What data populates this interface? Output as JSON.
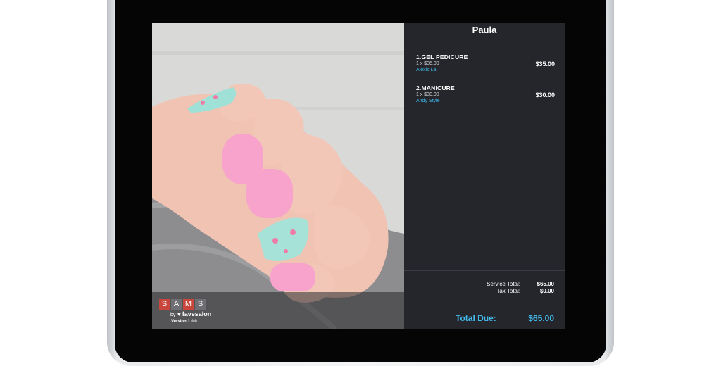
{
  "brand": {
    "logo_letters": [
      "S",
      "A",
      "M",
      "S"
    ],
    "by_text": "by",
    "partner": "favesalon",
    "version": "Version 1.0.0"
  },
  "receipt": {
    "customer_name": "Paula",
    "items": [
      {
        "name": "1.GEL PEDICURE",
        "qty_price": "1 x $35.00",
        "staff": "Alexis La",
        "amount": "$35.00"
      },
      {
        "name": "2.MANICURE",
        "qty_price": "1 x $30.00",
        "staff": "Andy Style",
        "amount": "$30.00"
      }
    ],
    "service_total_label": "Service Total:",
    "service_total": "$65.00",
    "tax_total_label": "Tax Total:",
    "tax_total": "$0.00",
    "total_due_label": "Total Due:",
    "total_due": "$65.00"
  },
  "colors": {
    "accent": "#43b9ea",
    "panel": "#25262c",
    "logo_red": "#c9463d"
  }
}
